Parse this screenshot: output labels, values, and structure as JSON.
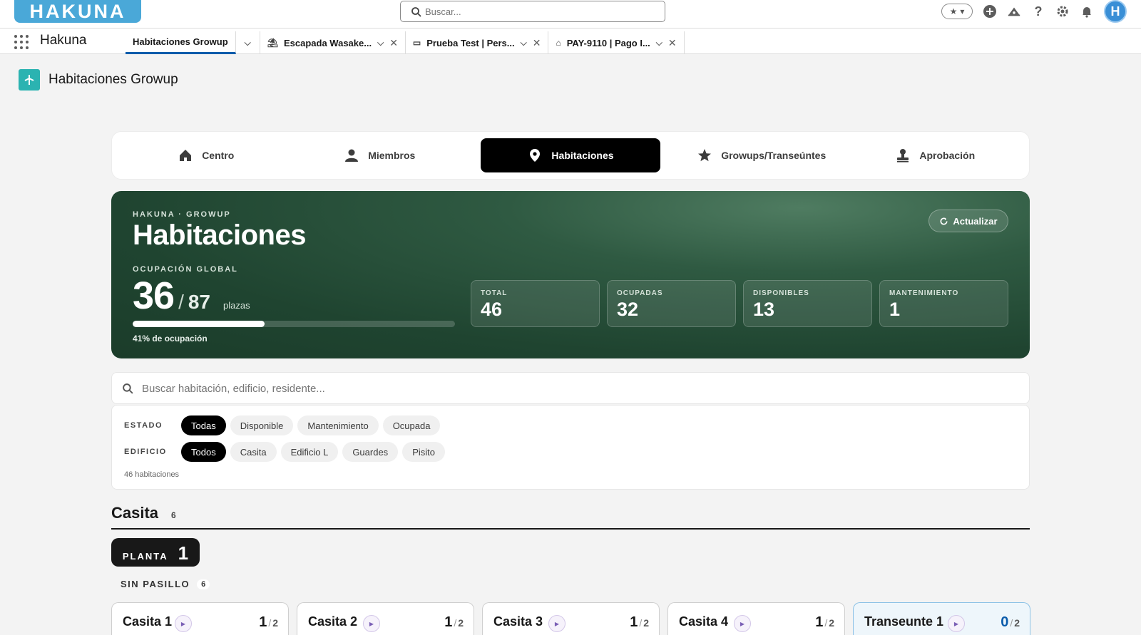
{
  "header": {
    "logo": "HAKUNA",
    "search_placeholder": "Buscar...",
    "avatar_initial": "H"
  },
  "nav": {
    "app_name": "Hakuna",
    "tabs": [
      {
        "label": "Habitaciones Growup",
        "active": true
      },
      {
        "label": "Escapada Wasake...",
        "icon": "travel-icon"
      },
      {
        "label": "Prueba Test | Pers...",
        "icon": "contact-card-icon"
      },
      {
        "label": "PAY-9110 | Pago I...",
        "icon": "bank-icon"
      }
    ]
  },
  "page": {
    "title": "Habitaciones Growup"
  },
  "modules": [
    {
      "label": "Centro",
      "icon": "home-icon"
    },
    {
      "label": "Miembros",
      "icon": "person-icon"
    },
    {
      "label": "Habitaciones",
      "icon": "location-pin-icon",
      "active": true
    },
    {
      "label": "Growups/Transeúntes",
      "icon": "star-icon"
    },
    {
      "label": "Aprobación",
      "icon": "stamp-icon"
    }
  ],
  "hero": {
    "eyebrow": "HAKUNA · GROWUP",
    "title": "Habitaciones",
    "occupancy_label": "OCUPACIÓN GLOBAL",
    "occupied": "36",
    "capacity": "87",
    "unit": "plazas",
    "occupancy_fraction": 0.41,
    "occupancy_text": "41% de ocupación",
    "refresh_label": "Actualizar",
    "stats": [
      {
        "label": "TOTAL",
        "value": "46"
      },
      {
        "label": "OCUPADAS",
        "value": "32"
      },
      {
        "label": "DISPONIBLES",
        "value": "13"
      },
      {
        "label": "MANTENIMIENTO",
        "value": "1"
      }
    ]
  },
  "room_search": {
    "placeholder": "Buscar habitación, edificio, residente..."
  },
  "filters": {
    "estado_label": "ESTADO",
    "estado_options": [
      "Todas",
      "Disponible",
      "Mantenimiento",
      "Ocupada"
    ],
    "estado_selected": "Todas",
    "edificio_label": "EDIFICIO",
    "edificio_options": [
      "Todos",
      "Casita",
      "Edificio L",
      "Guardes",
      "Pisito"
    ],
    "edificio_selected": "Todos",
    "count_text": "46 habitaciones"
  },
  "section": {
    "name": "Casita",
    "count": "6",
    "floor_label": "PLANTA",
    "floor_number": "1",
    "corridor_label": "SIN PASILLO",
    "corridor_count": "6",
    "rooms": [
      {
        "name": "Casita 1",
        "occupied": "1",
        "capacity": "2"
      },
      {
        "name": "Casita 2",
        "occupied": "1",
        "capacity": "2"
      },
      {
        "name": "Casita 3",
        "occupied": "1",
        "capacity": "2"
      },
      {
        "name": "Casita 4",
        "occupied": "1",
        "capacity": "2"
      },
      {
        "name": "Transeunte 1",
        "occupied": "0",
        "capacity": "2"
      }
    ]
  },
  "colors": {
    "accent": "#0b5cab",
    "hero_green": "#1f4430",
    "logo_blue": "#4aa8d8"
  }
}
